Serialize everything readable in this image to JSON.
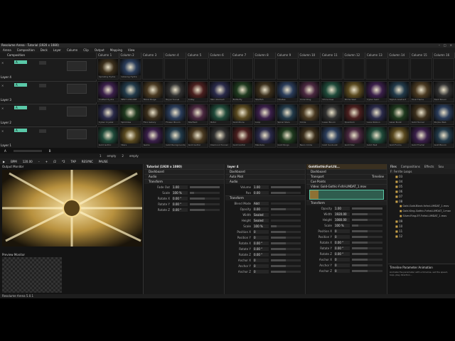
{
  "window": {
    "title": "Resolume Arena - Tutorial (1920 x 1080)",
    "controls": [
      "–",
      "□",
      "✕"
    ]
  },
  "menu": [
    "Arena",
    "Composition",
    "Deck",
    "Layer",
    "Column",
    "Clip",
    "Output",
    "Mapping",
    "View"
  ],
  "composition": {
    "label": "Composition"
  },
  "columns": [
    "Column 1",
    "Column 2",
    "Column 3",
    "Column 4",
    "Column 5",
    "Column 6",
    "Column 7",
    "Column 8",
    "Column 9",
    "Column 10",
    "Column 11",
    "Column 12",
    "Column 13",
    "Column 14",
    "Column 15",
    "Column 16"
  ],
  "layers": [
    {
      "name": "Layer 4",
      "group": "A",
      "clips": [
        "Spiraling Hydra",
        "Glowing Hydra",
        "",
        "",
        "",
        "",
        "",
        "",
        "",
        "",
        "",
        "",
        "",
        "",
        "",
        ""
      ]
    },
    {
      "name": "Layer 3",
      "group": "A",
      "clips": [
        "Crafted Hydra",
        "BEST CHROME",
        "Moiré Bulge",
        "Royal Tunnel",
        "X-Ray",
        "Neo Abstract",
        "Butterfly",
        "Starfish",
        "Ciliates",
        "Coral Ring",
        "Chris-Claw",
        "Portal Wall",
        "Cyber Swirl",
        "Stylish Abstract",
        "Dual Flame",
        "Swirl Bloom"
      ]
    },
    {
      "name": "Layer 2",
      "group": "A",
      "clips": [
        "Cyber Crystal",
        "Sprinkles",
        "Flux Galaxy",
        "Flower Bloom",
        "Starfield",
        "Rotor",
        "Gold Moire",
        "Loop",
        "Spiral Stars",
        "Circle",
        "Laser Bloom",
        "Quantum",
        "Lace Ribbon",
        "Laser Burst",
        "Gold Tunnel",
        "Purple Web"
      ]
    },
    {
      "name": "Layer 1",
      "group": "A",
      "clips": [
        "Gold Gothic",
        "Stars",
        "Gems",
        "Gold Backgrounds",
        "Gold Gothic",
        "Diamond Tunnel",
        "Gold Gothic",
        "Mandala",
        "Gold Rings",
        "Neon Circle",
        "Gold Sunburst",
        "Gold Star",
        "Gold Wall",
        "Gold Forms",
        "Gold Fractal",
        "Gold Bloom"
      ]
    }
  ],
  "deck": {
    "tabs": [
      "1",
      "2"
    ],
    "names": [
      "empty",
      "empty"
    ]
  },
  "transport": {
    "bpm_label": "BPM",
    "bpm": "120.00",
    "buttons": [
      "/2",
      "*2",
      "TAP",
      "RESYNC",
      "PAUSE"
    ]
  },
  "monitors": {
    "output": "Output Monitor",
    "preview": "Preview Monitor"
  },
  "composition_panel": {
    "title": "Tutorial (1920 x 1080)",
    "sections": [
      "Dashboard",
      "Audio",
      "Transform"
    ],
    "params": [
      {
        "k": "Fade Out",
        "v": "1.00",
        "p": 100
      },
      {
        "k": "Scale",
        "v": "100 %",
        "p": 15
      },
      {
        "k": "Rotate X",
        "v": "0.00 °",
        "p": 50
      },
      {
        "k": "Rotate Y",
        "v": "0.00 °",
        "p": 50
      },
      {
        "k": "Rotate Z",
        "v": "0.00 °",
        "p": 50
      }
    ]
  },
  "layer_panel": {
    "title": "layer 4",
    "sections": [
      "Dashboard",
      "Auto Pilot",
      "Audio"
    ],
    "audio": [
      {
        "k": "Volume",
        "v": "1.00",
        "p": 100
      },
      {
        "k": "Pan",
        "v": "0.00",
        "p": 50
      }
    ],
    "transform": "Transform",
    "params": [
      {
        "k": "Blend Mode",
        "v": "Add",
        "p": 0
      },
      {
        "k": "Opacity",
        "v": "0.00",
        "p": 50
      },
      {
        "k": "Width",
        "v": "Sealed",
        "p": 0
      },
      {
        "k": "Height",
        "v": "Sealed",
        "p": 0
      },
      {
        "k": "Scale",
        "v": "100 %",
        "p": 20
      },
      {
        "k": "Position X",
        "v": "0",
        "p": 50
      },
      {
        "k": "Position Y",
        "v": "0",
        "p": 50
      },
      {
        "k": "Rotate X",
        "v": "0.00 °",
        "p": 50
      },
      {
        "k": "Rotate Y",
        "v": "0.00 °",
        "p": 50
      },
      {
        "k": "Rotate Z",
        "v": "0.00 °",
        "p": 50
      },
      {
        "k": "Anchor X",
        "v": "0",
        "p": 50
      },
      {
        "k": "Anchor Y",
        "v": "0",
        "p": 50
      },
      {
        "k": "Anchor Z",
        "v": "0",
        "p": 50
      }
    ]
  },
  "clip_panel": {
    "title": "GoldGothicFurLfd...",
    "sections": [
      "Dashboard",
      "Transport",
      "Cue Points"
    ],
    "timeline": "Timeline",
    "video": "Video: Gold-Gothic-Fxfd-LIMDAT_1.mov",
    "transform": "Transform",
    "params": [
      {
        "k": "Opacity",
        "v": "1.00",
        "p": 100
      },
      {
        "k": "Width",
        "v": "1920.00",
        "p": 50
      },
      {
        "k": "Height",
        "v": "1080.00",
        "p": 50
      },
      {
        "k": "Scale",
        "v": "100 %",
        "p": 20
      },
      {
        "k": "Position X",
        "v": "0",
        "p": 50
      },
      {
        "k": "Position Y",
        "v": "0",
        "p": 50
      },
      {
        "k": "Rotate X",
        "v": "0.00 °",
        "p": 50
      },
      {
        "k": "Rotate Y",
        "v": "0.00 °",
        "p": 50
      },
      {
        "k": "Rotate Z",
        "v": "0.00 °",
        "p": 50
      },
      {
        "k": "Anchor X",
        "v": "0",
        "p": 50
      },
      {
        "k": "Anchor Y",
        "v": "0",
        "p": 50
      },
      {
        "k": "Anchor Z",
        "v": "0",
        "p": 50
      }
    ]
  },
  "files": {
    "tabs": [
      "Files",
      "Compositions",
      "Effects",
      "Sou"
    ],
    "path": "F: Ferrite Loops",
    "items": [
      "03",
      "04",
      "05",
      "06",
      "07",
      "08",
      "Gold-Gold-Black-fxfxd-LIMDAT_1.mov",
      "Gold-King-Gothic-Fxfxd-LIMDAT_1.mov",
      "Silver-Ring-EF-Fxfxd-LIMDAT_1.mov",
      "09",
      "10",
      "11",
      "12"
    ],
    "info_title": "Timeline Parameter Animation",
    "info_text": "Animate the parameter with a timeline, set the speed, loop, play direction..."
  },
  "footer": "Resolume Arena 5.0.1",
  "colors": {
    "accent": "#5ac9a8",
    "bg": "#141414",
    "gold": "#c9a24a"
  }
}
